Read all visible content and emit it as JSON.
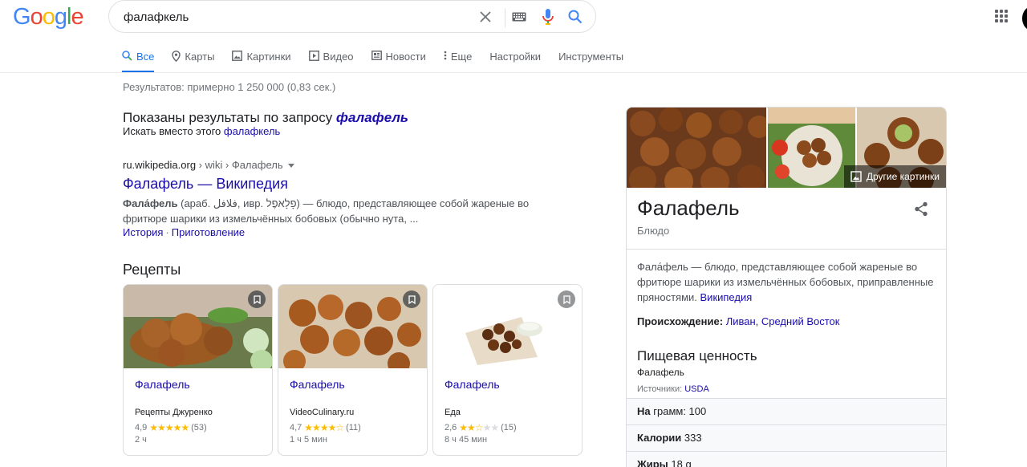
{
  "logo": {
    "letters": [
      "G",
      "o",
      "o",
      "g",
      "l",
      "e"
    ],
    "colors": [
      "#4285f4",
      "#ea4335",
      "#fbbc05",
      "#4285f4",
      "#34a853",
      "#ea4335"
    ]
  },
  "search": {
    "query": "фалафкель"
  },
  "tabs": [
    {
      "label": "Все",
      "icon": "search-icon",
      "active": true
    },
    {
      "label": "Карты",
      "icon": "map-pin-icon"
    },
    {
      "label": "Картинки",
      "icon": "image-icon"
    },
    {
      "label": "Видео",
      "icon": "play-icon"
    },
    {
      "label": "Новости",
      "icon": "news-icon"
    },
    {
      "label": "Еще",
      "icon": "more-vert-icon"
    },
    {
      "label": "Настройки"
    },
    {
      "label": "Инструменты"
    }
  ],
  "stats": "Результатов: примерно 1 250 000 (0,83 сек.)",
  "correction": {
    "prefix": "Показаны результаты по запросу ",
    "corrected": "фалафель",
    "instead_prefix": "Искать вместо этого ",
    "original": "фалафкель"
  },
  "result": {
    "domain": "ru.wikipedia.org",
    "path": " › wiki › Фалафель",
    "title": "Фалафель — Википедия",
    "snippet_bold": "Фала́фель",
    "snippet_rest": " (араб. فلافل, ивр. פָלָאפֶל) — блюдо, представляющее собой жареные во фритюре шарики из измельчённых бобовых (обычно нута, ...",
    "sitelinks": [
      "История",
      "Приготовление"
    ]
  },
  "recipes": {
    "heading": "Рецепты",
    "cards": [
      {
        "title": "Фалафель",
        "source": "Рецепты Джуренко",
        "rating": "4,9",
        "stars": 5,
        "reviews": "(53)",
        "time": "2 ч"
      },
      {
        "title": "Фалафель",
        "source": "VideoCulinary.ru",
        "rating": "4,7",
        "stars": 4.5,
        "reviews": "(11)",
        "time": "1 ч 5 мин"
      },
      {
        "title": "Фалафель",
        "source": "Еда",
        "rating": "2,6",
        "stars": 2.5,
        "reviews": "(15)",
        "time": "8 ч 45 мин"
      }
    ]
  },
  "knowledge_panel": {
    "more_images": "Другие картинки",
    "title": "Фалафель",
    "subtitle": "Блюдо",
    "description": "Фала́фель — блюдо, представляющее собой жареные во фритюре шарики из измельчённых бобовых, приправленные пряностями.",
    "description_link": "Википедия",
    "origin_label": "Происхождение:",
    "origin_value": "Ливан, Средний Восток",
    "nutrition_heading": "Пищевая ценность",
    "nutrition_item": "Фалафель",
    "sources_label": "Источники:",
    "sources_link": "USDA",
    "rows": [
      {
        "label": "На",
        "rest": " грамм: 100"
      },
      {
        "label": "Калории",
        "rest": " 333"
      },
      {
        "label": "Жиры",
        "rest": " 18 g"
      }
    ]
  },
  "colors": {
    "link": "#1a0dab",
    "accent": "#1a73e8",
    "star": "#fbbc04"
  }
}
